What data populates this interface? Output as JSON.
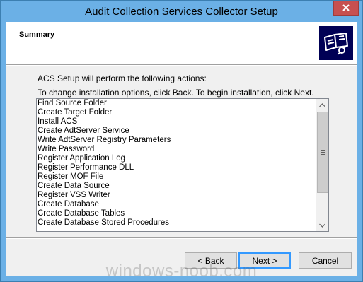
{
  "window": {
    "title": "Audit Collection Services Collector Setup"
  },
  "header": {
    "title": "Summary",
    "icon": "setup-book-icon"
  },
  "body": {
    "line1": "ACS Setup will perform the following actions:",
    "line2": "To change installation options, click Back. To begin installation, click Next."
  },
  "actions": [
    "Find Source Folder",
    "Create Target Folder",
    "Install ACS",
    "Create AdtServer Service",
    "Write AdtServer Registry Parameters",
    "Write Password",
    "Register Application Log",
    "Register Performance DLL",
    "Register MOF File",
    "Create Data Source",
    "Register VSS Writer",
    "Create Database",
    "Create Database Tables",
    "Create Database Stored Procedures"
  ],
  "buttons": {
    "back": "< Back",
    "next": "Next >",
    "cancel": "Cancel"
  },
  "watermark": "windows-noob.com",
  "colors": {
    "title_bar": "#6bb0e6",
    "close_button": "#c75050",
    "header_icon_bg": "#000055",
    "default_button_border": "#3399ff"
  }
}
